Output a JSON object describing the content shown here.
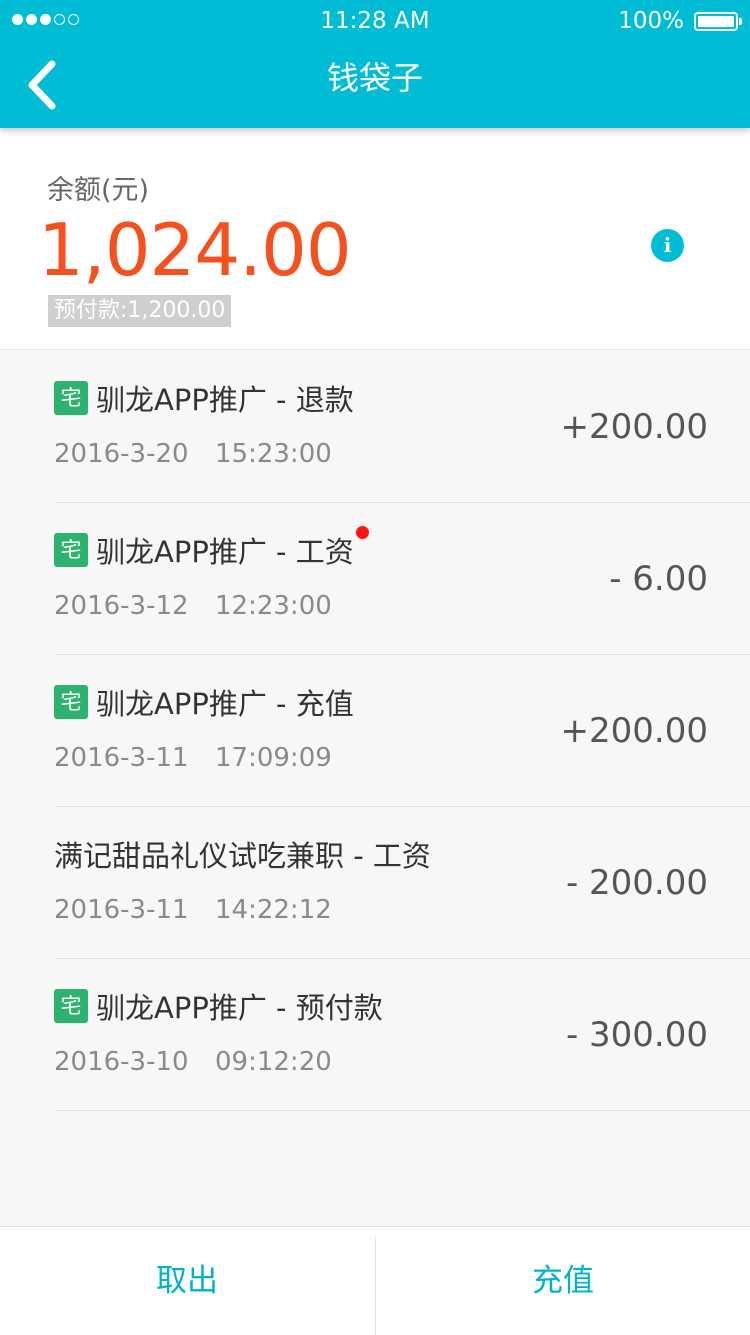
{
  "status_bar": {
    "signal_dots": [
      true,
      true,
      true,
      false,
      false
    ],
    "time": "11:28 AM",
    "battery": "100%"
  },
  "header": {
    "title": "钱袋子",
    "back_icon": "chevron-left-icon",
    "color": "#00bcd4"
  },
  "balance": {
    "label": "余额(元)",
    "amount": "1,024.00",
    "amount_color": "#f4511e",
    "prepaid": "预付款:1,200.00",
    "info_icon": "info-icon"
  },
  "transactions": [
    {
      "tag": "宅",
      "title": "驯龙APP推广 - 退款",
      "date": "2016-3-20",
      "time": "15:23:00",
      "amount": "+200.00",
      "unread": false
    },
    {
      "tag": "宅",
      "title": "驯龙APP推广 - 工资",
      "date": "2016-3-12",
      "time": "12:23:00",
      "amount": "- 6.00",
      "unread": true
    },
    {
      "tag": "宅",
      "title": "驯龙APP推广 - 充值",
      "date": "2016-3-11",
      "time": "17:09:09",
      "amount": "+200.00",
      "unread": false
    },
    {
      "tag": "",
      "title": "满记甜品礼仪试吃兼职 - 工资",
      "date": "2016-3-11",
      "time": "14:22:12",
      "amount": "- 200.00",
      "unread": false
    },
    {
      "tag": "宅",
      "title": "驯龙APP推广 - 预付款",
      "date": "2016-3-10",
      "time": "09:12:20",
      "amount": "- 300.00",
      "unread": false
    }
  ],
  "footer": {
    "withdraw_label": "取出",
    "recharge_label": "充值"
  },
  "colors": {
    "tag": "#2db36e",
    "unread_dot": "#ff1212",
    "footer_text": "#00b3cc"
  }
}
